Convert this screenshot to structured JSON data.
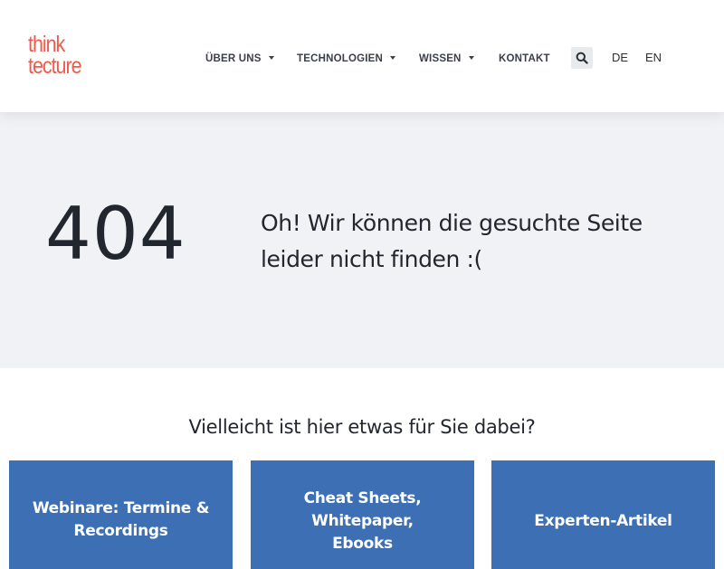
{
  "header": {
    "logo": {
      "line1": "think",
      "line2": "tecture"
    },
    "nav": [
      {
        "label": "ÜBER UNS",
        "dropdown": true
      },
      {
        "label": "TECHNOLOGIEN",
        "dropdown": true
      },
      {
        "label": "WISSEN",
        "dropdown": true
      },
      {
        "label": "KONTAKT",
        "dropdown": false
      }
    ],
    "search_icon": "search-icon",
    "languages": [
      "DE",
      "EN"
    ]
  },
  "hero": {
    "code": "404",
    "message": "Oh! Wir können die gesuchte Seite leider nicht finden :("
  },
  "suggestions": {
    "heading": "Vielleicht ist hier etwas für Sie dabei?",
    "cards": [
      {
        "label": "Webinare: Termine & Recordings"
      },
      {
        "label": "Cheat Sheets, Whitepaper, Ebooks"
      },
      {
        "label": "Experten-Artikel"
      }
    ]
  },
  "colors": {
    "brand": "#ef5a4b",
    "card_bg": "#3c6fb4",
    "hero_bg": "#f1f2f6",
    "text": "#22262e"
  }
}
